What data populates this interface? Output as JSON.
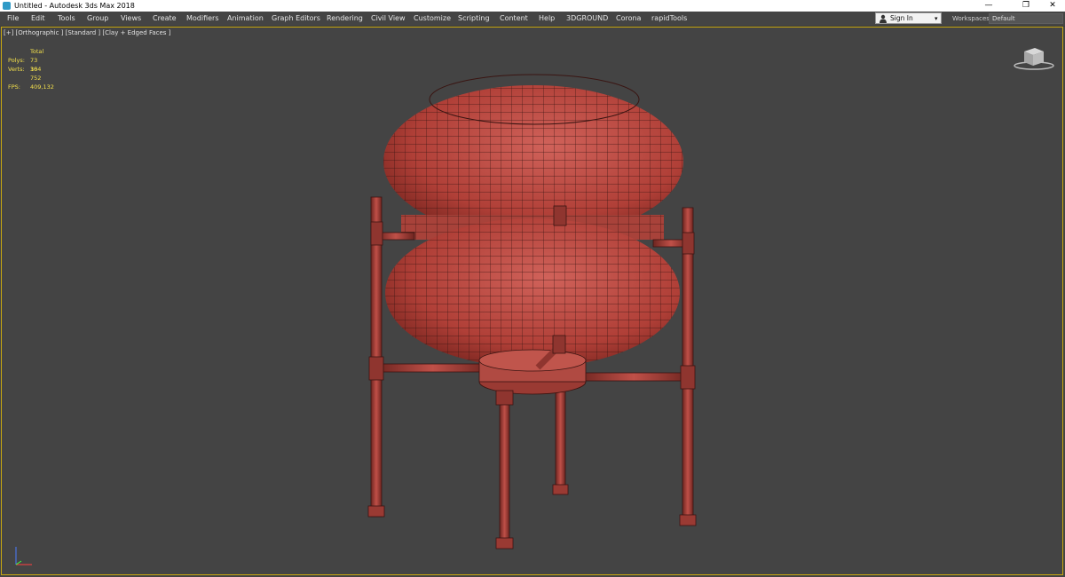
{
  "titlebar": {
    "title": "Untitled - Autodesk 3ds Max 2018",
    "minimize": "—",
    "restore": "❐",
    "close": "✕"
  },
  "menu": [
    "File",
    "Edit",
    "Tools",
    "Group",
    "Views",
    "Create",
    "Modifiers",
    "Animation",
    "Graph Editors",
    "Rendering",
    "Civil View",
    "Customize",
    "Scripting",
    "Content",
    "Help",
    "3DGROUND",
    "Corona",
    "rapidTools"
  ],
  "signin": {
    "label": "Sign In",
    "icon": "person-icon",
    "caret": "▾"
  },
  "workspaces": {
    "label": "Workspaces:",
    "value": "Default"
  },
  "viewport": {
    "label": "[+] [Orthographic ] [Standard ] [Clay + Edged Faces ]",
    "stats": {
      "header": "Total",
      "polys_label": "Polys:",
      "polys": "73 104",
      "verts_label": "Verts:",
      "verts": "36 752",
      "fps_label": "FPS:",
      "fps": "409,132"
    }
  },
  "colors": {
    "background": "#444444",
    "model_fill": "#b5453c",
    "model_edge": "#3a1512",
    "stats_text": "#f4e04b",
    "viewport_border": "#c8a810"
  }
}
